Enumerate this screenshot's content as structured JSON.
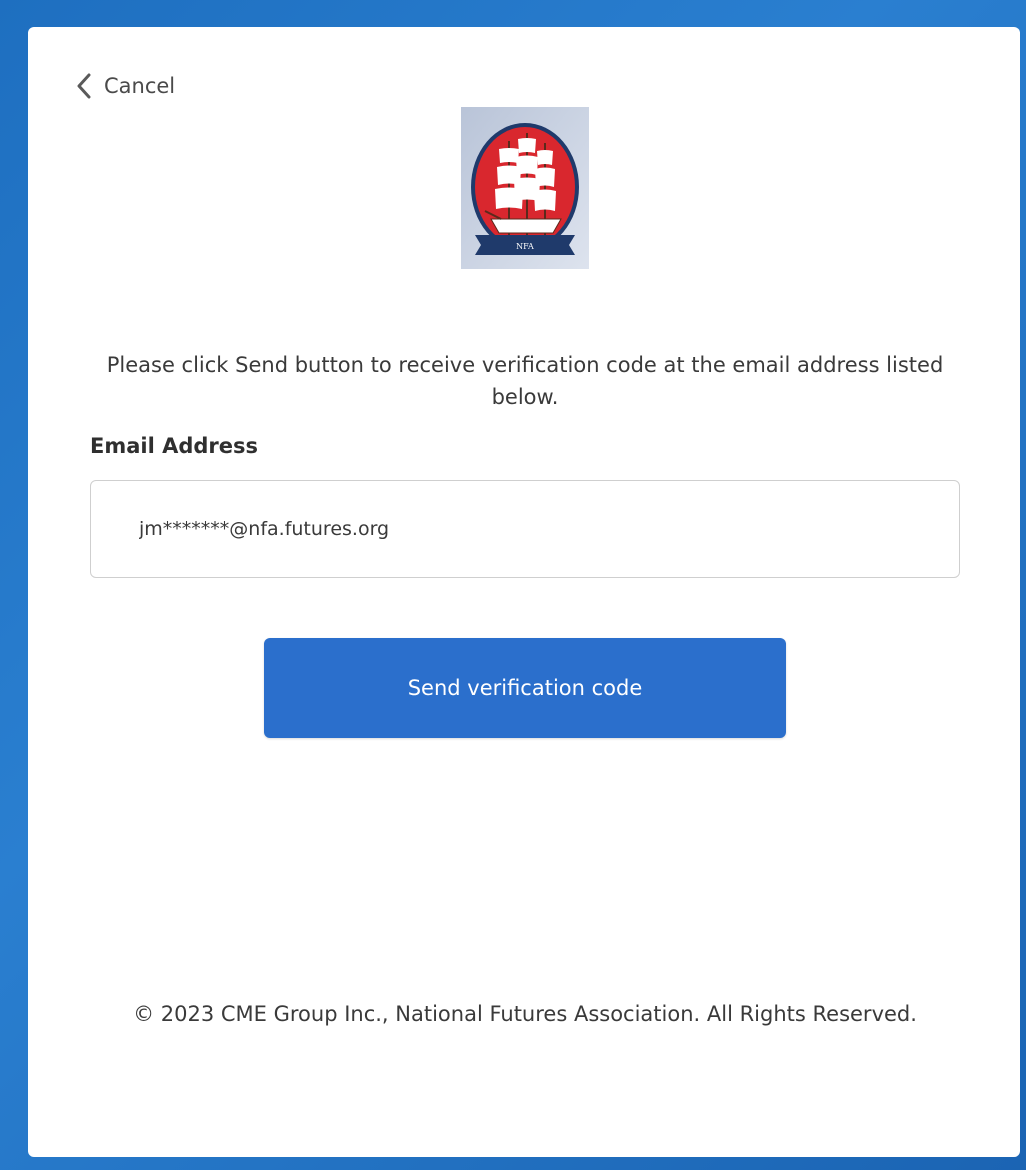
{
  "nav": {
    "cancel_label": "Cancel"
  },
  "logo": {
    "banner_text": "NFA"
  },
  "instructions": "Please click Send button to receive verification code at the email address listed below.",
  "email": {
    "label": "Email Address",
    "value": "jm*******@nfa.futures.org"
  },
  "send_button": {
    "label": "Send verification code"
  },
  "footer": {
    "copyright": "© 2023 CME Group Inc., National Futures Association. All Rights Reserved."
  },
  "colors": {
    "background_accent": "#2a7fd0",
    "button": "#2b6fcc",
    "logo_red": "#d9272e",
    "logo_navy": "#1f3a6b"
  },
  "icons": {
    "cancel": "chevron-left-icon"
  }
}
